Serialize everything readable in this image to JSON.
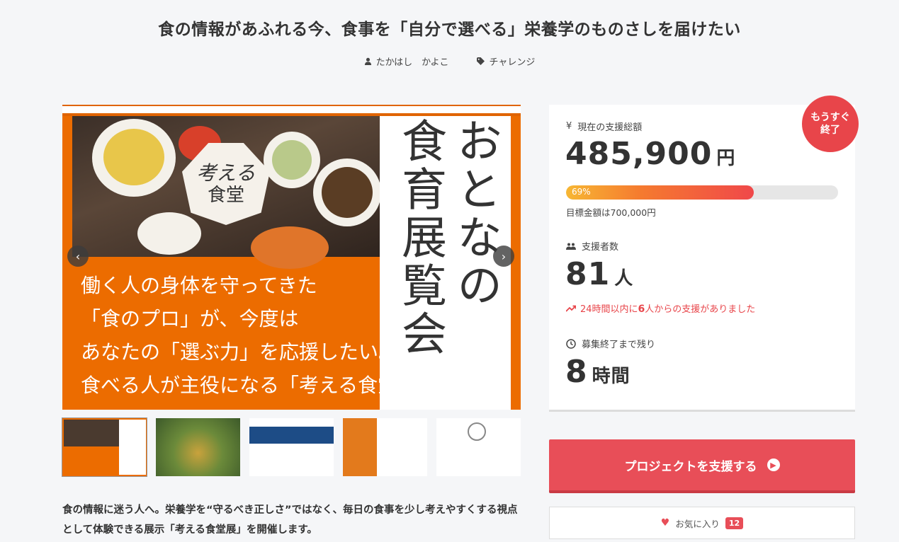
{
  "header": {
    "title": "食の情報があふれる今、食事を「自分で選べる」栄養学のものさしを届けたい",
    "author": "たかはし　かよこ",
    "category": "チャレンジ"
  },
  "hero": {
    "badge_line1": "考える",
    "badge_line2": "食堂",
    "vertical_col1": "おとなの",
    "vertical_col2": "食育展覧会",
    "lines": [
      "働く人の身体を守ってきた",
      "「食のプロ」が、今度は",
      "あなたの「選ぶ力」を応援したい。",
      "食べる人が主役になる「考える食堂」展を!"
    ],
    "prev_arrow": "‹",
    "next_arrow": "›"
  },
  "description": "食の情報に迷う人へ。栄養学を“守るべき正しさ”ではなく、毎日の食事を少し考えやすくする視点として体験できる展示「考える食堂展」を開催します。",
  "stats": {
    "badge_line1": "もうすぐ",
    "badge_line2": "終了",
    "total_label": "現在の支援総額",
    "total_value": "485,900",
    "total_unit": "円",
    "progress_percent": 69,
    "progress_label": "69%",
    "goal": "目標金額は700,000円",
    "supporters_label": "支援者数",
    "supporters_value": "81",
    "supporters_unit": "人",
    "recent_pre": "24時間以内に",
    "recent_count": "6",
    "recent_post": "人からの支援がありました",
    "remaining_label": "募集終了まで残り",
    "remaining_value": "8",
    "remaining_unit": "時間",
    "currency_icon": "¥"
  },
  "actions": {
    "support_label": "プロジェクトを支援する",
    "favorite_label": "お気に入り",
    "favorite_count": "12"
  },
  "colors": {
    "accent": "#e84e58",
    "hero_orange": "#ec6c00"
  }
}
